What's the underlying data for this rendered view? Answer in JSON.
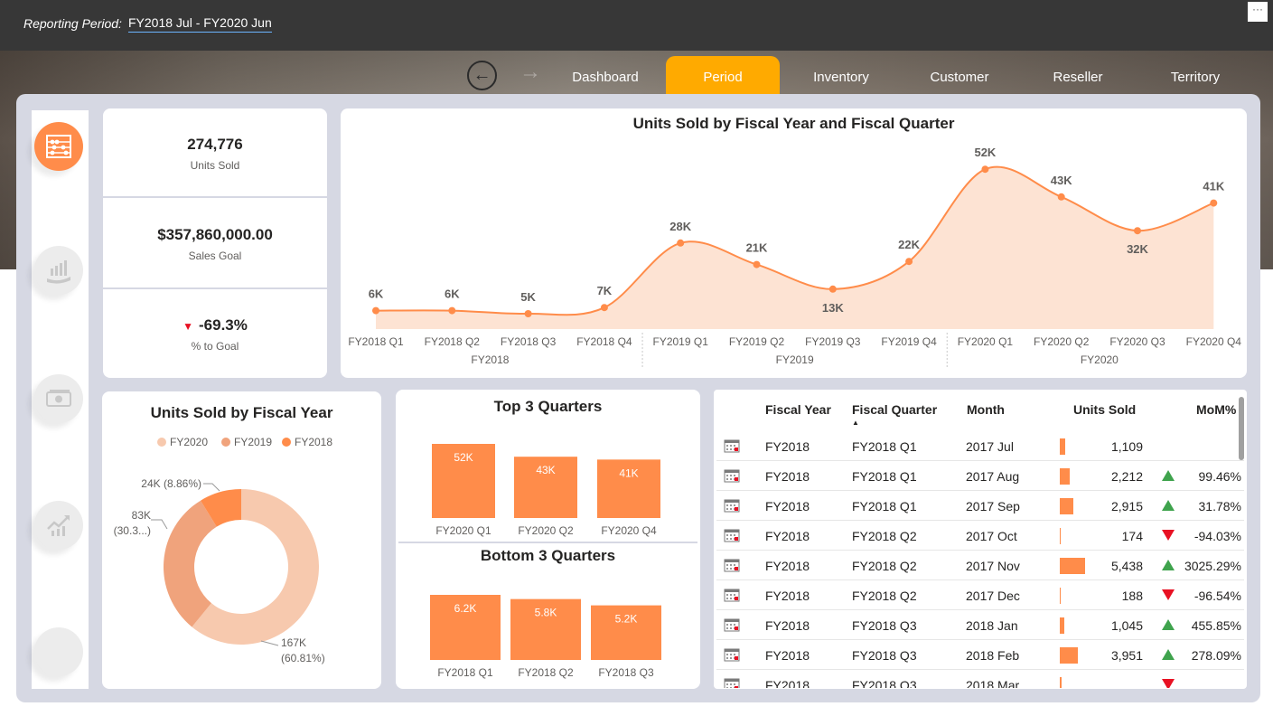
{
  "header": {
    "period_label": "Reporting Period:",
    "period_value": "FY2018  Jul - FY2020  Jun",
    "more_icon": "ellipsis-icon"
  },
  "nav": {
    "back_icon": "back-arrow-icon",
    "forward_icon": "forward-arrow-icon",
    "tabs": [
      {
        "label": "Dashboard",
        "active": false
      },
      {
        "label": "Period",
        "active": true
      },
      {
        "label": "Inventory",
        "active": false
      },
      {
        "label": "Customer",
        "active": false
      },
      {
        "label": "Reseller",
        "active": false
      },
      {
        "label": "Territory",
        "active": false
      }
    ],
    "accent": "#ffaa00"
  },
  "sidebar": {
    "buttons": [
      {
        "icon": "abacus-icon",
        "active": true
      },
      {
        "icon": "growth-hand-icon",
        "active": false
      },
      {
        "icon": "cash-icon",
        "active": false
      },
      {
        "icon": "trend-chart-icon",
        "active": false
      },
      {
        "icon": "blank-icon",
        "active": false
      }
    ]
  },
  "kpis": [
    {
      "value": "274,776",
      "label": "Units Sold"
    },
    {
      "value": "$357,860,000.00",
      "label": "Sales Goal"
    },
    {
      "value": "-69.3%",
      "label": "% to Goal",
      "indicator": "down"
    }
  ],
  "colors": {
    "accent": "#ff8c4a",
    "fill": "#fde3d3",
    "panel": "#d6d8e3",
    "fy2020": "#f7c9ae",
    "fy2019": "#f0a37c",
    "fy2018": "#ff8c4a",
    "up": "#3fa34d",
    "down": "#e81123"
  },
  "chart_data": [
    {
      "type": "area",
      "title": "Units Sold by Fiscal Year and Fiscal Quarter",
      "categories": [
        "FY2018 Q1",
        "FY2018 Q2",
        "FY2018 Q3",
        "FY2018 Q4",
        "FY2019 Q1",
        "FY2019 Q2",
        "FY2019 Q3",
        "FY2019 Q4",
        "FY2020 Q1",
        "FY2020 Q2",
        "FY2020 Q3",
        "FY2020 Q4"
      ],
      "groups": [
        "FY2018",
        "FY2019",
        "FY2020"
      ],
      "values": [
        6000,
        6000,
        5000,
        7000,
        28000,
        21000,
        13000,
        22000,
        52000,
        43000,
        32000,
        41000
      ],
      "labels": [
        "6K",
        "6K",
        "5K",
        "7K",
        "28K",
        "21K",
        "13K",
        "22K",
        "52K",
        "43K",
        "32K",
        "41K"
      ],
      "ylim": [
        0,
        60000
      ]
    },
    {
      "type": "pie",
      "title": "Units Sold by Fiscal Year",
      "legend": [
        "FY2020",
        "FY2019",
        "FY2018"
      ],
      "slices": [
        {
          "name": "FY2020",
          "value": 167000,
          "label": "167K",
          "pct": "(60.81%)"
        },
        {
          "name": "FY2019",
          "value": 83000,
          "label": "83K",
          "pct": "(30.3...)"
        },
        {
          "name": "FY2018",
          "value": 24000,
          "label": "24K (8.86%)",
          "pct": ""
        }
      ]
    },
    {
      "type": "bar",
      "title": "Top 3 Quarters",
      "categories": [
        "FY2020 Q1",
        "FY2020 Q2",
        "FY2020 Q4"
      ],
      "values": [
        52000,
        43000,
        41000
      ],
      "labels": [
        "52K",
        "43K",
        "41K"
      ]
    },
    {
      "type": "bar",
      "title": "Bottom 3 Quarters",
      "categories": [
        "FY2018 Q1",
        "FY2018 Q2",
        "FY2018 Q3"
      ],
      "values": [
        6200,
        5800,
        5200
      ],
      "labels": [
        "6.2K",
        "5.8K",
        "5.2K"
      ]
    }
  ],
  "table": {
    "headers": [
      "Fiscal Year",
      "Fiscal Quarter",
      "Month",
      "Units Sold",
      "MoM%"
    ],
    "sort_icon": "sort-ascending-icon",
    "row_icon": "calendar-icon",
    "rows": [
      {
        "year": "FY2018",
        "quarter": "FY2018 Q1",
        "month": "2017 Jul",
        "units": "1,109",
        "units_n": 1109,
        "mom": "",
        "dir": ""
      },
      {
        "year": "FY2018",
        "quarter": "FY2018 Q1",
        "month": "2017 Aug",
        "units": "2,212",
        "units_n": 2212,
        "mom": "99.46%",
        "dir": "up"
      },
      {
        "year": "FY2018",
        "quarter": "FY2018 Q1",
        "month": "2017 Sep",
        "units": "2,915",
        "units_n": 2915,
        "mom": "31.78%",
        "dir": "up"
      },
      {
        "year": "FY2018",
        "quarter": "FY2018 Q2",
        "month": "2017 Oct",
        "units": "174",
        "units_n": 174,
        "mom": "-94.03%",
        "dir": "down"
      },
      {
        "year": "FY2018",
        "quarter": "FY2018 Q2",
        "month": "2017 Nov",
        "units": "5,438",
        "units_n": 5438,
        "mom": "3025.29%",
        "dir": "up"
      },
      {
        "year": "FY2018",
        "quarter": "FY2018 Q2",
        "month": "2017 Dec",
        "units": "188",
        "units_n": 188,
        "mom": "-96.54%",
        "dir": "down"
      },
      {
        "year": "FY2018",
        "quarter": "FY2018 Q3",
        "month": "2018 Jan",
        "units": "1,045",
        "units_n": 1045,
        "mom": "455.85%",
        "dir": "up"
      },
      {
        "year": "FY2018",
        "quarter": "FY2018 Q3",
        "month": "2018 Feb",
        "units": "3,951",
        "units_n": 3951,
        "mom": "278.09%",
        "dir": "up"
      }
    ]
  }
}
